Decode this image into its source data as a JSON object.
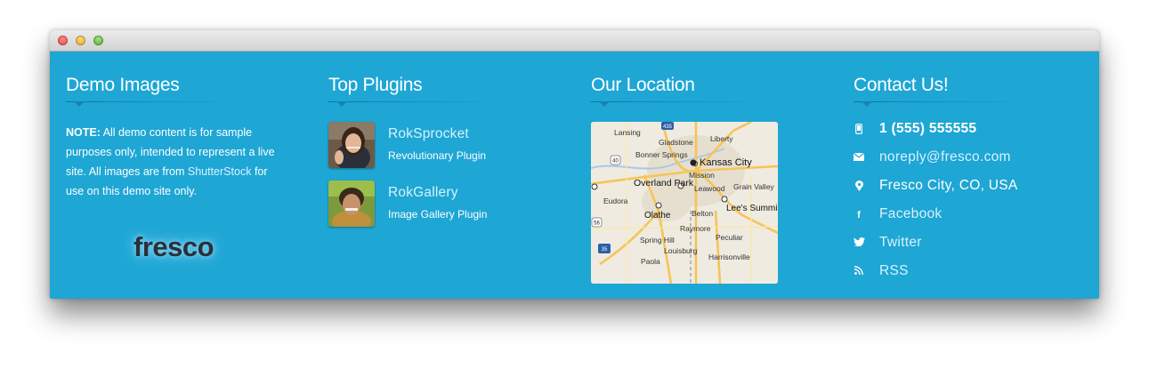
{
  "columns": {
    "demo": {
      "title": "Demo Images",
      "note_label": "NOTE:",
      "note_text_1": "All demo content is for sample purposes only, intended to represent a live site. All images are from",
      "note_link": "ShutterStock",
      "note_text_2": "for use on this demo site only.",
      "logo": "fresco"
    },
    "plugins": {
      "title": "Top Plugins",
      "items": [
        {
          "name": "RokSprocket",
          "desc": "Revolutionary Plugin"
        },
        {
          "name": "RokGallery",
          "desc": "Image Gallery Plugin"
        }
      ]
    },
    "location": {
      "title": "Our Location",
      "map_labels": [
        "Lansing",
        "Liberty",
        "Gladstone",
        "Bonner Springs",
        "Kansas City",
        "Mission",
        "Overland Park",
        "Leawood",
        "Grain Valley",
        "Eudora",
        "Olathe",
        "Belton",
        "Lee's Summit",
        "Raymore",
        "Spring Hill",
        "Peculiar",
        "Louisburg",
        "Paola",
        "Harrisonville"
      ],
      "route_shields": [
        "435",
        "40",
        "56",
        "35"
      ]
    },
    "contact": {
      "title": "Contact Us!",
      "items": [
        {
          "icon": "phone-icon",
          "text": "1 (555) 555555"
        },
        {
          "icon": "envelope-icon",
          "text": "noreply@fresco.com"
        },
        {
          "icon": "map-pin-icon",
          "text": "Fresco City, CO, USA"
        },
        {
          "icon": "facebook-icon",
          "text": "Facebook"
        },
        {
          "icon": "twitter-icon",
          "text": "Twitter"
        },
        {
          "icon": "rss-icon",
          "text": "RSS"
        }
      ]
    }
  },
  "colors": {
    "background": "#1ea6d5",
    "link": "#d6f2ff",
    "text": "#ffffff"
  }
}
